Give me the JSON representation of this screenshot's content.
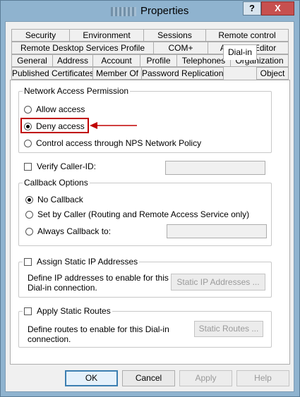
{
  "window": {
    "title": "Properties",
    "help_label": "?",
    "close_label": "X"
  },
  "tabs": [
    {
      "label": "Security"
    },
    {
      "label": "Environment"
    },
    {
      "label": "Sessions"
    },
    {
      "label": "Remote control"
    },
    {
      "label": "Remote Desktop Services Profile"
    },
    {
      "label": "COM+"
    },
    {
      "label": "Attribute Editor"
    },
    {
      "label": "General"
    },
    {
      "label": "Address"
    },
    {
      "label": "Account"
    },
    {
      "label": "Profile"
    },
    {
      "label": "Telephones"
    },
    {
      "label": "Organization"
    },
    {
      "label": "Published Certificates"
    },
    {
      "label": "Member Of"
    },
    {
      "label": "Password Replication"
    },
    {
      "label": "Dial-in"
    },
    {
      "label": "Object"
    }
  ],
  "active_tab": "Dial-in",
  "network_access": {
    "legend": "Network Access Permission",
    "options": [
      {
        "label": "Allow access",
        "checked": false
      },
      {
        "label": "Deny access",
        "checked": true
      },
      {
        "label": "Control access through NPS Network Policy",
        "checked": false
      }
    ]
  },
  "verify_caller_id": {
    "label": "Verify Caller-ID:",
    "checked": false,
    "value": ""
  },
  "callback": {
    "legend": "Callback Options",
    "options": [
      {
        "label": "No Callback",
        "checked": true
      },
      {
        "label": "Set by Caller (Routing and Remote Access Service only)",
        "checked": false
      },
      {
        "label": "Always Callback to:",
        "checked": false
      }
    ],
    "always_value": ""
  },
  "static_ip": {
    "label": "Assign Static IP Addresses",
    "checked": false,
    "description_line1": "Define IP addresses to enable for this",
    "description_line2": "Dial-in connection.",
    "button_label": "Static IP Addresses ..."
  },
  "static_routes": {
    "label": "Apply Static Routes",
    "checked": false,
    "description_line1": "Define routes to enable for this Dial-in",
    "description_line2": "connection.",
    "button_label": "Static Routes ..."
  },
  "footer": {
    "ok_label": "OK",
    "cancel_label": "Cancel",
    "apply_label": "Apply",
    "help_label": "Help"
  },
  "annotation_color": "#c00000"
}
